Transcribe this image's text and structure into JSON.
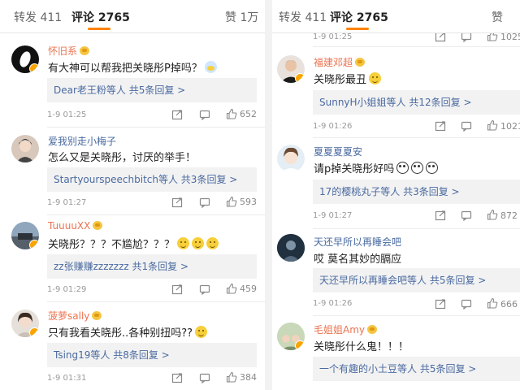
{
  "left": {
    "tabs": {
      "forward": "转发 411",
      "comments": "评论 2765",
      "likes": "赞 1万"
    },
    "comments": [
      {
        "user": "怀旧系",
        "text": "有大神可以帮我把关晓彤P掉吗？",
        "reply": "Dear老王粉等人  共5条回复 >",
        "time": "1-9 01:25",
        "likes": "652"
      },
      {
        "user": "爱我别走小梅子",
        "text": "怎么又是关晓彤，讨厌的举手！",
        "reply": "Startyourspeechbitch等人  共3条回复 >",
        "time": "1-9 01:27",
        "likes": "593"
      },
      {
        "user": "TuuuuXX",
        "text": "关晓彤？？？不尴尬？？？",
        "reply": "zz张赚赚zzzzzzz  共1条回复 >",
        "time": "1-9 01:29",
        "likes": "459"
      },
      {
        "user": "菠萝sally",
        "text": "只有我看关晓彤..各种别扭吗??",
        "reply": "Tsing19等人  共8条回复 >",
        "time": "1-9 01:31",
        "likes": "384"
      }
    ]
  },
  "right": {
    "tabs": {
      "forward": "转发 411",
      "comments": "评论 2765",
      "likes": "赞"
    },
    "top_meta": {
      "time": "1-9 01:25",
      "likes": "1025"
    },
    "comments": [
      {
        "user": "福建邓超",
        "text": "关晓彤最丑",
        "reply": "SunnyH小姐姐等人  共12条回复 >",
        "time": "1-9 01:26",
        "likes": "1021"
      },
      {
        "user": "夏夏夏夏安",
        "text": "请p掉关晓彤好吗",
        "reply": "17的樱桃丸子等人  共3条回复 >",
        "time": "1-9 01:27",
        "likes": "872"
      },
      {
        "user": "天还早所以再睡会吧",
        "text": "哎  莫名其妙的膈应",
        "reply": "天还早所以再睡会吧等人  共5条回复 >",
        "time": "1-9 01:26",
        "likes": "666"
      },
      {
        "user": "毛姐姐Amy",
        "text": "关晓彤什么鬼！！！",
        "reply": "一个有趣的小土豆等人  共5条回复 >",
        "time": "",
        "likes": ""
      }
    ]
  },
  "colors": {
    "accent": "#ff8200",
    "username": "#eb7350",
    "reply_link": "#4a6aa0"
  },
  "icons": [
    "share-icon",
    "comment-icon",
    "like-icon",
    "vip-badge-icon",
    "medal-icon"
  ]
}
